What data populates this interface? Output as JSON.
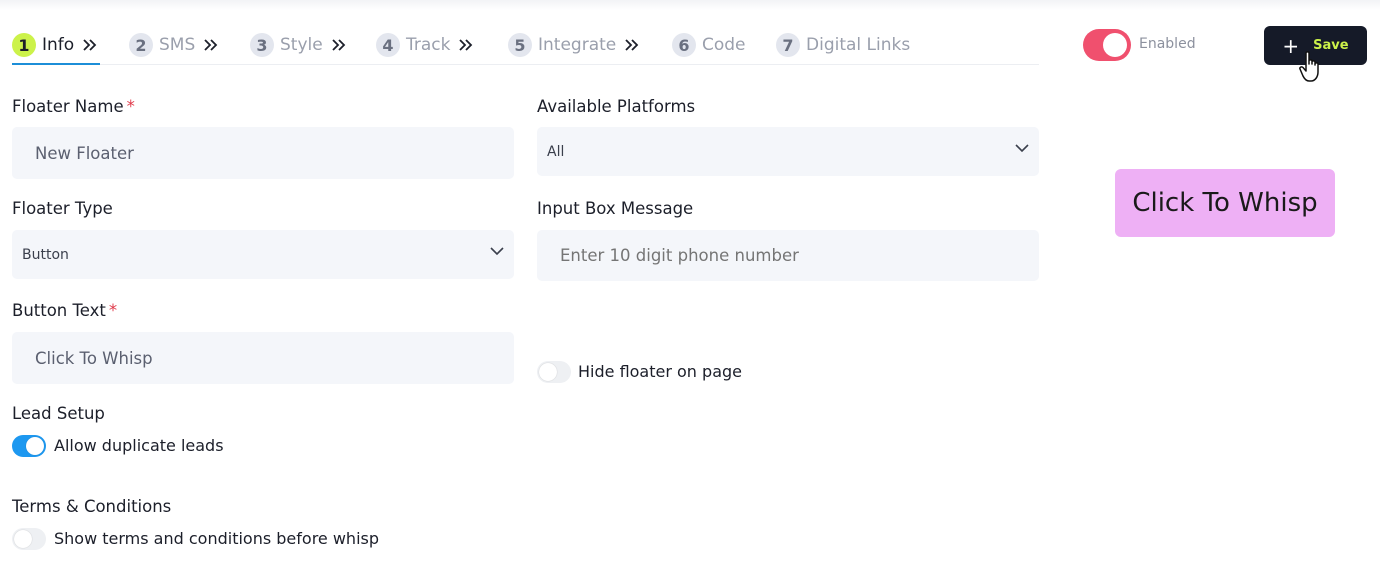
{
  "steps": [
    {
      "num": "1",
      "label": "Info",
      "chevron": true
    },
    {
      "num": "2",
      "label": "SMS",
      "chevron": true
    },
    {
      "num": "3",
      "label": "Style",
      "chevron": true
    },
    {
      "num": "4",
      "label": "Track",
      "chevron": true
    },
    {
      "num": "5",
      "label": "Integrate",
      "chevron": true
    },
    {
      "num": "6",
      "label": "Code",
      "chevron": false
    },
    {
      "num": "7",
      "label": "Digital Links",
      "chevron": false
    }
  ],
  "header": {
    "enabled_label": "Enabled",
    "enabled_on": true,
    "save_label": "Save",
    "save_plus": "+"
  },
  "form": {
    "floater_name": {
      "label": "Floater Name",
      "required": "*",
      "value": "New Floater"
    },
    "available_platforms": {
      "label": "Available Platforms",
      "value": "All"
    },
    "floater_type": {
      "label": "Floater Type",
      "value": "Button"
    },
    "input_box_message": {
      "label": "Input Box Message",
      "placeholder": "Enter 10 digit phone number"
    },
    "button_text": {
      "label": "Button Text",
      "required": "*",
      "value": "Click To Whisp"
    },
    "hide_floater": {
      "label": "Hide floater on page",
      "on": false
    },
    "lead_setup": {
      "heading": "Lead Setup",
      "allow_duplicates_label": "Allow duplicate leads",
      "on": true
    },
    "terms": {
      "heading": "Terms & Conditions",
      "show_terms_label": "Show terms and conditions before whisp",
      "on": false
    }
  },
  "preview": {
    "button_text": "Click To Whisp"
  },
  "colors": {
    "accent_lime": "#ccf24a",
    "toggle_pink": "#f0506e",
    "toggle_blue": "#1d98f0",
    "save_bg": "#151a28",
    "preview_bg": "#eeb0f5",
    "field_bg": "#f4f6fa"
  },
  "icons": {
    "step_chevron": "double-chevron-right-icon",
    "select_chevron": "chevron-down-icon",
    "cursor": "hand-pointer-icon"
  }
}
